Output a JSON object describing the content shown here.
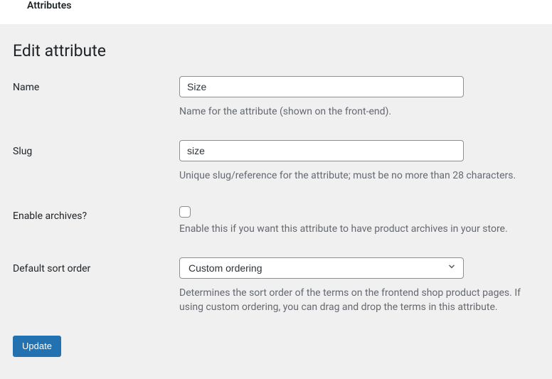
{
  "topbar": {
    "tab": "Attributes"
  },
  "page": {
    "title": "Edit attribute"
  },
  "form": {
    "name": {
      "label": "Name",
      "value": "Size",
      "help": "Name for the attribute (shown on the front-end)."
    },
    "slug": {
      "label": "Slug",
      "value": "size",
      "help": "Unique slug/reference for the attribute; must be no more than 28 characters."
    },
    "archives": {
      "label": "Enable archives?",
      "help": "Enable this if you want this attribute to have product archives in your store."
    },
    "sort": {
      "label": "Default sort order",
      "selected": "Custom ordering",
      "help": "Determines the sort order of the terms on the frontend shop product pages. If using custom ordering, you can drag and drop the terms in this attribute."
    }
  },
  "buttons": {
    "submit": "Update"
  }
}
